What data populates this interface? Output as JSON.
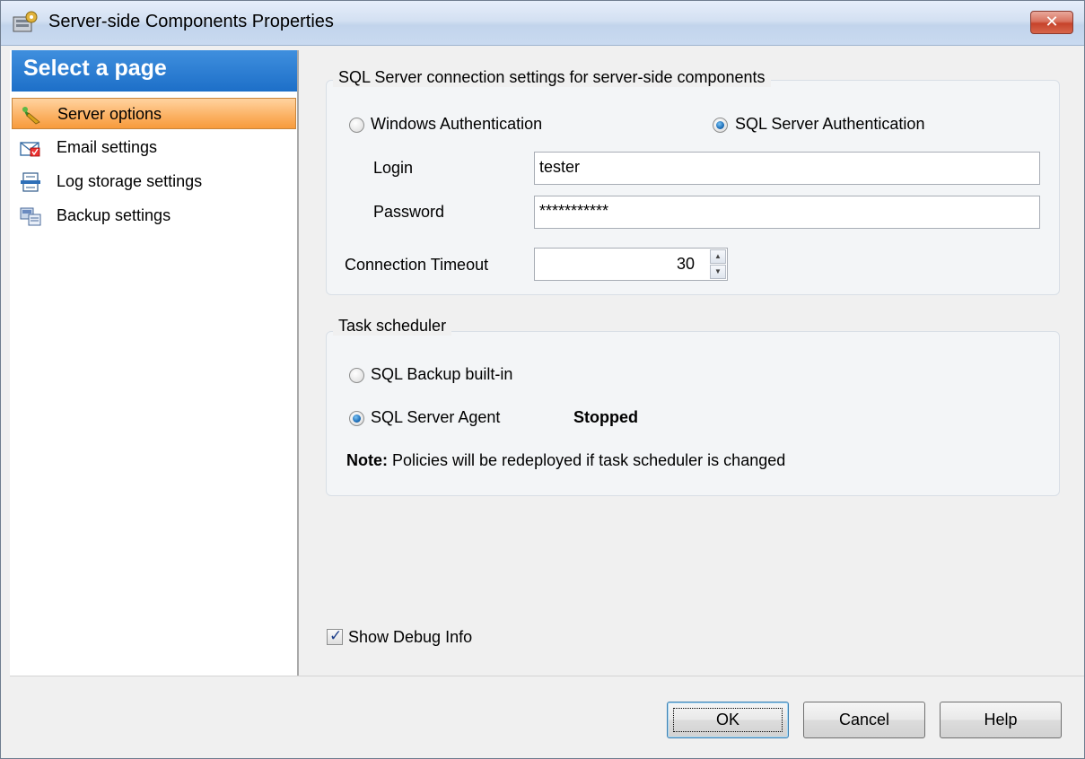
{
  "window": {
    "title": "Server-side Components Properties",
    "close_label": "✕"
  },
  "nav": {
    "header": "Select a page",
    "items": [
      {
        "label": "Server options",
        "icon": "server-options-icon",
        "active": true
      },
      {
        "label": "Email settings",
        "icon": "email-icon",
        "active": false
      },
      {
        "label": "Log storage settings",
        "icon": "log-storage-icon",
        "active": false
      },
      {
        "label": "Backup settings",
        "icon": "backup-icon",
        "active": false
      }
    ]
  },
  "connection": {
    "legend": "SQL Server connection settings for server-side components",
    "windows_auth_label": "Windows Authentication",
    "sql_auth_label": "SQL Server Authentication",
    "selected_auth": "SQL Server Authentication",
    "login_label": "Login",
    "login_value": "tester",
    "password_label": "Password",
    "password_value": "***********",
    "timeout_label": "Connection Timeout",
    "timeout_value": "30"
  },
  "scheduler": {
    "legend": "Task scheduler",
    "builtin_label": "SQL Backup built-in",
    "agent_label": "SQL Server Agent",
    "selected": "SQL Server Agent",
    "agent_status": "Stopped",
    "note_bold": "Note:",
    "note_text": " Policies will be redeployed if task scheduler is changed"
  },
  "debug": {
    "label": "Show Debug Info",
    "checked": true
  },
  "buttons": {
    "ok": "OK",
    "cancel": "Cancel",
    "help": "Help"
  },
  "colors": {
    "nav_header": "#1d6fc8",
    "active_item": "#fbb061",
    "close_button": "#c6432b"
  }
}
